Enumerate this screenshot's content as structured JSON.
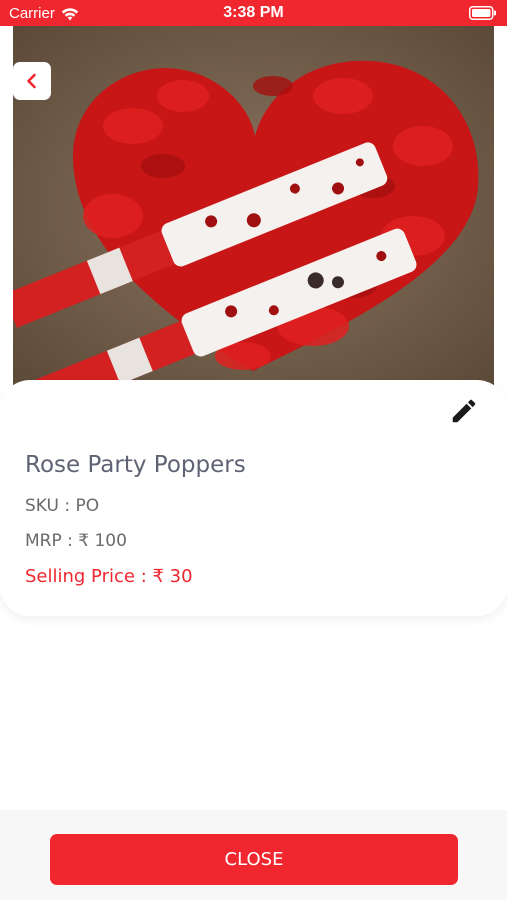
{
  "status_bar": {
    "carrier": "Carrier",
    "time": "3:38 PM",
    "wifi_icon": "wifi-icon",
    "battery_icon": "battery-icon"
  },
  "product": {
    "image_description_icon": "product-photo",
    "name": "Rose Party Poppers",
    "sku_text": "SKU : PO",
    "mrp_text": "MRP : ₹ 100",
    "selling_price_text": "Selling Price : ₹ 30"
  },
  "actions": {
    "back_icon": "chevron-left-icon",
    "edit_icon": "pencil-icon",
    "close_label": "CLOSE"
  },
  "colors": {
    "accent": "#f0272f",
    "title_text": "#5f6373",
    "body_text": "#6a6a6a",
    "footer_bg": "#f7f7f7"
  }
}
